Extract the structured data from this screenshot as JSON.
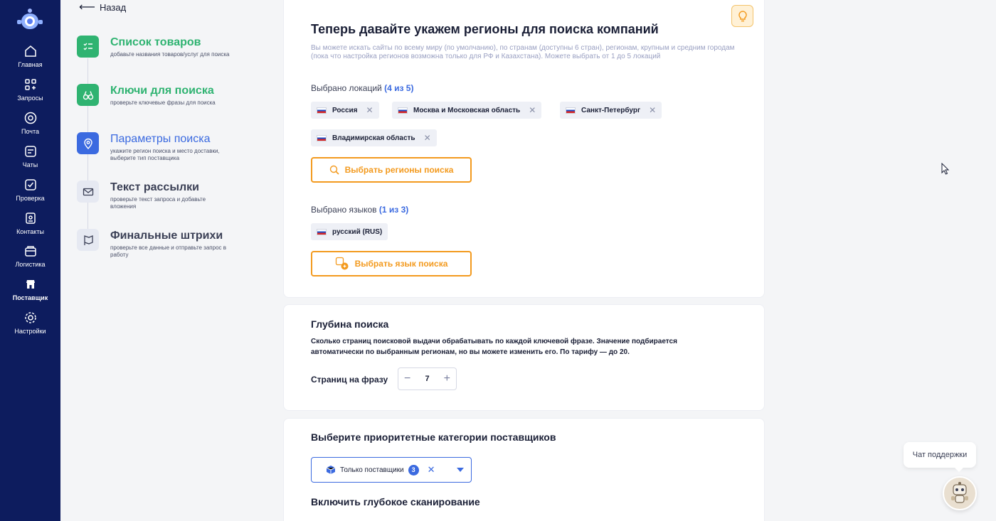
{
  "nav": {
    "items": [
      {
        "label": "Главная",
        "icon": "home-icon"
      },
      {
        "label": "Запросы",
        "icon": "requests-icon"
      },
      {
        "label": "Почта",
        "icon": "mail-at-icon"
      },
      {
        "label": "Чаты",
        "icon": "chat-icon"
      },
      {
        "label": "Проверка",
        "icon": "check-icon"
      },
      {
        "label": "Контакты",
        "icon": "contacts-icon"
      },
      {
        "label": "Логистика",
        "icon": "logistics-icon"
      },
      {
        "label": "Поставщик",
        "icon": "supplier-icon"
      },
      {
        "label": "Настройки",
        "icon": "gear-icon"
      }
    ]
  },
  "back_label": "Назад",
  "steps": [
    {
      "title": "Список товаров",
      "desc": "добавьте названия товаров/услуг для поиска",
      "icon": "checklist-icon",
      "color": "#2fb371",
      "state": "done"
    },
    {
      "title": "Ключи для поиска",
      "desc": "проверьте ключевые фразы для поиска",
      "icon": "binoculars-icon",
      "color": "#2fb371",
      "state": "done"
    },
    {
      "title": "Параметры поиска",
      "desc": "укажите регион поиска и место доставки, выберите тип поставщика",
      "icon": "location-pin-icon",
      "color": "#3b6ae0",
      "state": "active"
    },
    {
      "title": "Текст рассылки",
      "desc": "проверьте текст запроса и добавьте вложения",
      "icon": "envelope-icon",
      "color": "#3a3f55",
      "state": "pending"
    },
    {
      "title": "Финальные штрихи",
      "desc": "проверьте все данные и отправьте запрос в работу",
      "icon": "flag-icon",
      "color": "#3a3f55",
      "state": "pending"
    }
  ],
  "regions": {
    "title": "Теперь давайте укажем регионы для поиска компаний",
    "description": "Вы можете искать сайты по всему миру (по умолчанию), по странам (доступны 6 стран), регионам, крупным и средним городам (пока что настройка регионов возможна только для РФ и Казахстана). Можете выбрать от 1 до 5 локаций",
    "selected_label": "Выбрано локаций",
    "selected_count": "(4 из 5)",
    "locations": [
      "Россия",
      "Москва и Московская область",
      "Санкт-Петербург",
      "Владимирская область"
    ],
    "choose_regions_button": "Выбрать регионы поиска",
    "languages_label": "Выбрано языков",
    "languages_count": "(1 из 3)",
    "languages": [
      "русский (RUS)"
    ],
    "choose_language_button": "Выбрать язык поиска"
  },
  "depth": {
    "title": "Глубина поиска",
    "description": "Сколько страниц поисковой выдачи обрабатывать по каждой ключевой фразе. Значение подбирается автоматически по выбранным регионам, но вы можете изменить его. По тарифу — до 20.",
    "pages_label": "Страниц на фразу",
    "pages_value": "7",
    "minus": "−",
    "plus": "+"
  },
  "suppliers": {
    "title": "Выберите приоритетные категории поставщиков",
    "selected_value": "Только поставщики",
    "selected_badge": "3",
    "deep_scan_title": "Включить глубокое сканирование"
  },
  "support": {
    "label": "Чат поддержки"
  },
  "colors": {
    "nav_bg": "#0d1c5e",
    "accent_orange": "#f39a1e",
    "accent_blue": "#3b6ae0",
    "done_green": "#2fb371"
  }
}
